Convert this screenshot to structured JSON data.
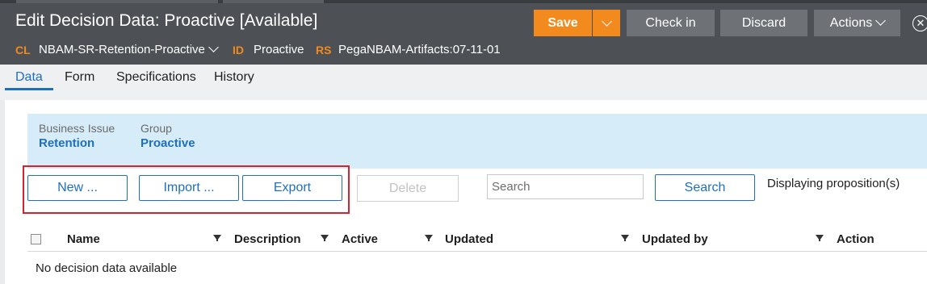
{
  "header": {
    "title": "Edit Decision Data: Proactive [Available]",
    "class_key": "CL",
    "class_value": "NBAM-SR-Retention-Proactive",
    "id_key": "ID",
    "id_value": "Proactive",
    "rs_key": "RS",
    "rs_value": "PegaNBAM-Artifacts:07-11-01",
    "buttons": {
      "save": "Save",
      "check_in": "Check in",
      "discard": "Discard",
      "actions": "Actions"
    }
  },
  "tabs": [
    {
      "label": "Data",
      "active": true
    },
    {
      "label": "Form",
      "active": false
    },
    {
      "label": "Specifications",
      "active": false
    },
    {
      "label": "History",
      "active": false
    }
  ],
  "context": {
    "business_issue_label": "Business Issue",
    "business_issue_value": "Retention",
    "group_label": "Group",
    "group_value": "Proactive"
  },
  "toolbar": {
    "new": "New ...",
    "import": "Import ...",
    "export": "Export",
    "delete": "Delete",
    "search_placeholder": "Search",
    "search_button": "Search",
    "displaying": "Displaying proposition(s)"
  },
  "table": {
    "columns": [
      "Name",
      "Description",
      "Active",
      "Updated",
      "Updated by",
      "Action"
    ],
    "empty_message": "No decision data available"
  },
  "colors": {
    "header_bg": "#4d5155",
    "accent_orange": "#f28a1e",
    "link_blue": "#1f6fbf",
    "band_bg": "#d6ecf8",
    "highlight_red": "#d3232e"
  }
}
